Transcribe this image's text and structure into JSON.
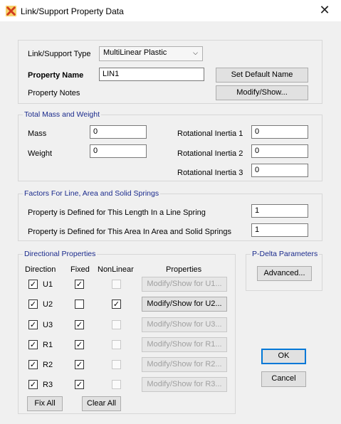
{
  "window": {
    "title": "Link/Support Property Data",
    "close_glyph": "✕"
  },
  "top": {
    "link_type_label": "Link/Support Type",
    "link_type_value": "MultiLinear Plastic",
    "property_name_label": "Property Name",
    "property_name_value": "LIN1",
    "set_default_button": "Set Default Name",
    "notes_label": "Property Notes",
    "modify_show_button": "Modify/Show..."
  },
  "mass": {
    "title": "Total Mass and Weight",
    "mass_label": "Mass",
    "mass_value": "0",
    "weight_label": "Weight",
    "weight_value": "0",
    "ri1_label": "Rotational Inertia 1",
    "ri1_value": "0",
    "ri2_label": "Rotational Inertia 2",
    "ri2_value": "0",
    "ri3_label": "Rotational Inertia 3",
    "ri3_value": "0"
  },
  "factors": {
    "title": "Factors For Line, Area and Solid Springs",
    "line_label": "Property is Defined for This Length In a Line Spring",
    "line_value": "1",
    "area_label": "Property is Defined for This Area In Area and Solid Springs",
    "area_value": "1"
  },
  "directional": {
    "title": "Directional Properties",
    "headers": {
      "direction": "Direction",
      "fixed": "Fixed",
      "nonlinear": "NonLinear",
      "properties": "Properties"
    },
    "rows": [
      {
        "dir": "U1",
        "fixed": true,
        "nonlinear": false,
        "button": "Modify/Show for U1..."
      },
      {
        "dir": "U2",
        "fixed": false,
        "nonlinear": true,
        "button": "Modify/Show for U2..."
      },
      {
        "dir": "U3",
        "fixed": true,
        "nonlinear": false,
        "button": "Modify/Show for U3..."
      },
      {
        "dir": "R1",
        "fixed": true,
        "nonlinear": false,
        "button": "Modify/Show for R1..."
      },
      {
        "dir": "R2",
        "fixed": true,
        "nonlinear": false,
        "button": "Modify/Show for R2..."
      },
      {
        "dir": "R3",
        "fixed": true,
        "nonlinear": false,
        "button": "Modify/Show for R3..."
      }
    ],
    "fix_all_button": "Fix All",
    "clear_all_button": "Clear All"
  },
  "pdelta": {
    "title": "P-Delta Parameters",
    "advanced_button": "Advanced..."
  },
  "dialog_buttons": {
    "ok": "OK",
    "cancel": "Cancel"
  },
  "colors": {
    "group_title": "#1a2a8c",
    "default_button_border": "#0078d7"
  },
  "icons": {
    "app": "sap-app-icon",
    "close": "close-icon",
    "dropdown": "chevron-down-icon",
    "check": "check-icon"
  }
}
